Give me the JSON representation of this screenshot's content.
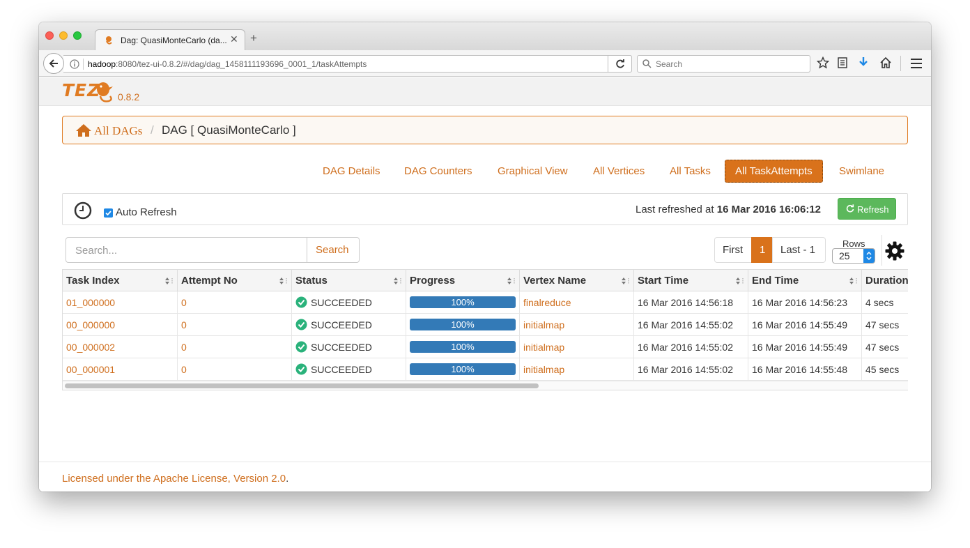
{
  "browser": {
    "tab_title": "Dag: QuasiMonteCarlo (da...",
    "url_host": "hadoop",
    "url_rest": ":8080/tez-ui-0.8.2/#/dag/dag_1458111193696_0001_1/taskAttempts",
    "search_placeholder": "Search"
  },
  "app": {
    "logo_text": "TEZ",
    "version": "0.8.2"
  },
  "breadcrumb": {
    "root_label": "All DAGs",
    "separator": "/",
    "current": "DAG [ QuasiMonteCarlo ]"
  },
  "tabs": [
    {
      "label": "DAG Details",
      "active": false
    },
    {
      "label": "DAG Counters",
      "active": false
    },
    {
      "label": "Graphical View",
      "active": false
    },
    {
      "label": "All Vertices",
      "active": false
    },
    {
      "label": "All Tasks",
      "active": false
    },
    {
      "label": "All TaskAttempts",
      "active": true
    },
    {
      "label": "Swimlane",
      "active": false
    }
  ],
  "refresh": {
    "auto_refresh_label": "Auto Refresh",
    "auto_refresh_checked": true,
    "last_refreshed_prefix": "Last refreshed at",
    "last_refreshed_time": "16 Mar 2016 16:06:12",
    "refresh_button": "Refresh"
  },
  "search": {
    "placeholder": "Search...",
    "button": "Search"
  },
  "pagination": {
    "first": "First",
    "current": "1",
    "last": "Last - 1",
    "rows_label": "Rows",
    "rows_value": "25"
  },
  "table": {
    "columns": [
      "Task Index",
      "Attempt No",
      "Status",
      "Progress",
      "Vertex Name",
      "Start Time",
      "End Time",
      "Duration"
    ],
    "rows": [
      {
        "task_index": "01_000000",
        "attempt_no": "0",
        "status": "SUCCEEDED",
        "progress": "100%",
        "progress_fraction": 1.0,
        "vertex_name": "finalreduce",
        "start_time": "16 Mar 2016 14:56:18",
        "end_time": "16 Mar 2016 14:56:23",
        "duration": "4 secs"
      },
      {
        "task_index": "00_000000",
        "attempt_no": "0",
        "status": "SUCCEEDED",
        "progress": "100%",
        "progress_fraction": 1.0,
        "vertex_name": "initialmap",
        "start_time": "16 Mar 2016 14:55:02",
        "end_time": "16 Mar 2016 14:55:49",
        "duration": "47 secs"
      },
      {
        "task_index": "00_000002",
        "attempt_no": "0",
        "status": "SUCCEEDED",
        "progress": "100%",
        "progress_fraction": 1.0,
        "vertex_name": "initialmap",
        "start_time": "16 Mar 2016 14:55:02",
        "end_time": "16 Mar 2016 14:55:49",
        "duration": "47 secs"
      },
      {
        "task_index": "00_000001",
        "attempt_no": "0",
        "status": "SUCCEEDED",
        "progress": "100%",
        "progress_fraction": 1.0,
        "vertex_name": "initialmap",
        "start_time": "16 Mar 2016 14:55:02",
        "end_time": "16 Mar 2016 14:55:48",
        "duration": "45 secs"
      }
    ]
  },
  "footer": {
    "license_link": "Licensed under the Apache License, Version 2.0",
    "trailing": "."
  },
  "colors": {
    "accent": "#cf6e1d",
    "active_tab": "#d9721b",
    "refresh_button": "#5cb85c",
    "progress_bar": "#337ab7",
    "success": "#2ab27b"
  },
  "icons": {
    "home": "home-icon",
    "clock": "clock-icon",
    "refresh": "refresh-icon",
    "gear": "gear-icon",
    "status": "check-circle-icon",
    "sort": "sort-icon"
  }
}
